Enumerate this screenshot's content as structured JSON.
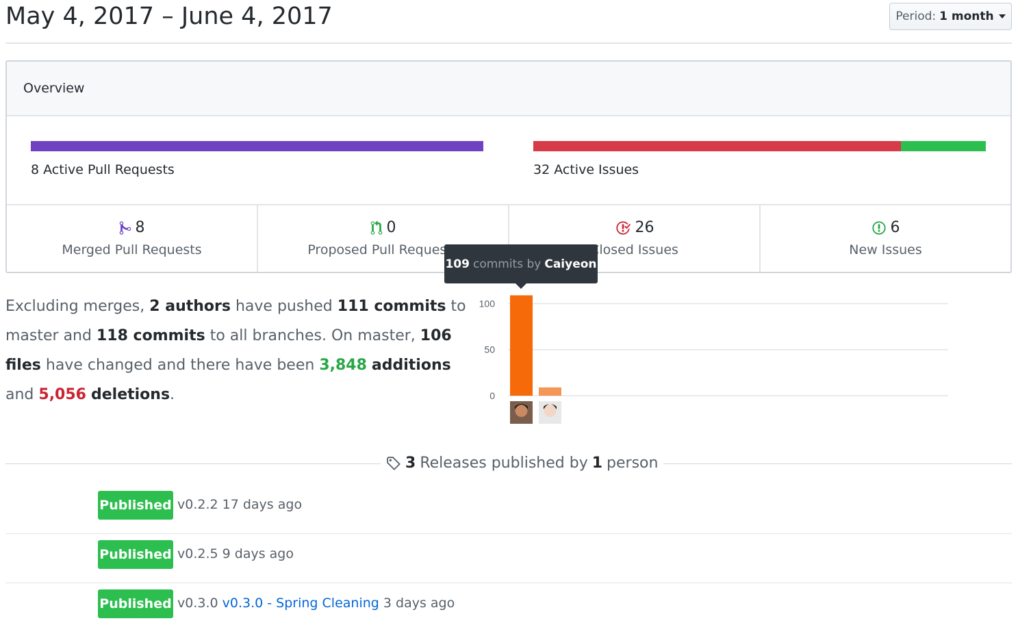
{
  "header": {
    "title": "May 4, 2017 – June 4, 2017",
    "period_label": "Period:",
    "period_value": "1 month"
  },
  "overview": {
    "title": "Overview",
    "pull_requests": {
      "count": "8",
      "label": "Active Pull Requests",
      "merged_fraction": 1.0
    },
    "issues": {
      "count": "32",
      "label": "Active Issues",
      "closed_fraction": 0.8125,
      "new_fraction": 0.1875
    },
    "stats": [
      {
        "icon": "git-merge-icon",
        "count": "8",
        "label": "Merged Pull Requests",
        "color": "#6f42c1"
      },
      {
        "icon": "git-pull-request-icon",
        "count": "0",
        "label": "Proposed Pull Requests",
        "color": "#28a745"
      },
      {
        "icon": "issue-closed-icon",
        "count": "26",
        "label": "Closed Issues",
        "color": "#cb2431"
      },
      {
        "icon": "issue-opened-icon",
        "count": "6",
        "label": "New Issues",
        "color": "#28a745"
      }
    ]
  },
  "summary": {
    "p1": "Excluding merges,",
    "authors": "2 authors",
    "p2": "have pushed",
    "commits_master": "111 commits",
    "p3": "to master and",
    "commits_all": "118 commits",
    "p4": "to all branches. On master,",
    "files": "106 files",
    "p5": "have changed and there have been",
    "additions_num": "3,848",
    "additions_word": "additions",
    "p6": "and",
    "deletions_num": "5,056",
    "deletions_word": "deletions",
    "p7": "."
  },
  "tooltip": {
    "count": "109",
    "middle": "commits by",
    "author": "Caiyeon"
  },
  "chart_data": {
    "type": "bar",
    "categories": [
      "Caiyeon",
      ""
    ],
    "values": [
      109,
      9
    ],
    "yticks": [
      "100",
      "50",
      "0"
    ],
    "ylim": [
      0,
      110
    ],
    "colors": [
      "#f66a0a",
      "#f49756"
    ]
  },
  "releases": {
    "count": "3",
    "text1": "Releases published by",
    "people": "1",
    "text2": "person",
    "items": [
      {
        "badge": "Published",
        "tag": "v0.2.2",
        "title": "",
        "ago": "17 days ago"
      },
      {
        "badge": "Published",
        "tag": "v0.2.5",
        "title": "",
        "ago": "9 days ago"
      },
      {
        "badge": "Published",
        "tag": "v0.3.0",
        "title": "v0.3.0 - Spring Cleaning",
        "ago": "3 days ago"
      }
    ]
  },
  "colors": {
    "purple": "#6f42c1",
    "red": "#d73a49",
    "green": "#2cbe4e",
    "link": "#0366d6"
  }
}
